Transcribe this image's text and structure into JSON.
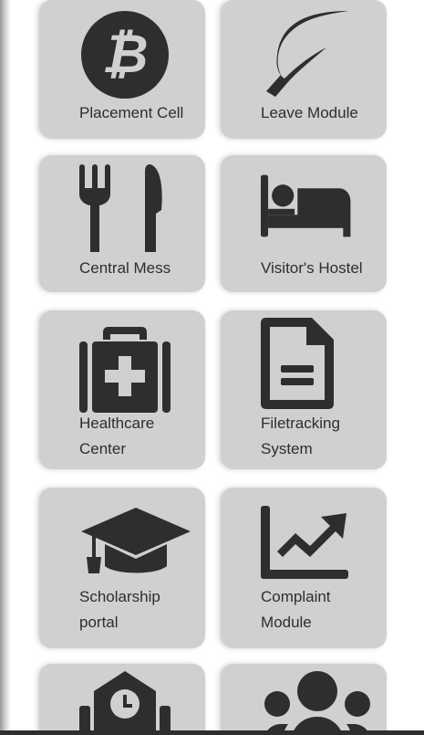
{
  "tiles": [
    {
      "label": "Placement Cell",
      "icon": "bitcoin-icon"
    },
    {
      "label": "Leave Module",
      "icon": "leaf-icon"
    },
    {
      "label": "Central Mess",
      "icon": "utensils-icon"
    },
    {
      "label": "Visitor's Hostel",
      "icon": "bed-icon"
    },
    {
      "label": "Healthcare\nCenter",
      "icon": "medical-kit-icon"
    },
    {
      "label": "Filetracking\nSystem",
      "icon": "file-icon"
    },
    {
      "label": "Scholarship\nportal",
      "icon": "graduation-cap-icon"
    },
    {
      "label": "Complaint\nModule",
      "icon": "chart-line-icon"
    },
    {
      "label": "",
      "icon": "school-clock-icon"
    },
    {
      "label": "",
      "icon": "users-icon"
    }
  ],
  "colors": {
    "tile_bg": "#d0d0d0",
    "icon": "#2e2e2e",
    "text": "#2e2e2e"
  }
}
